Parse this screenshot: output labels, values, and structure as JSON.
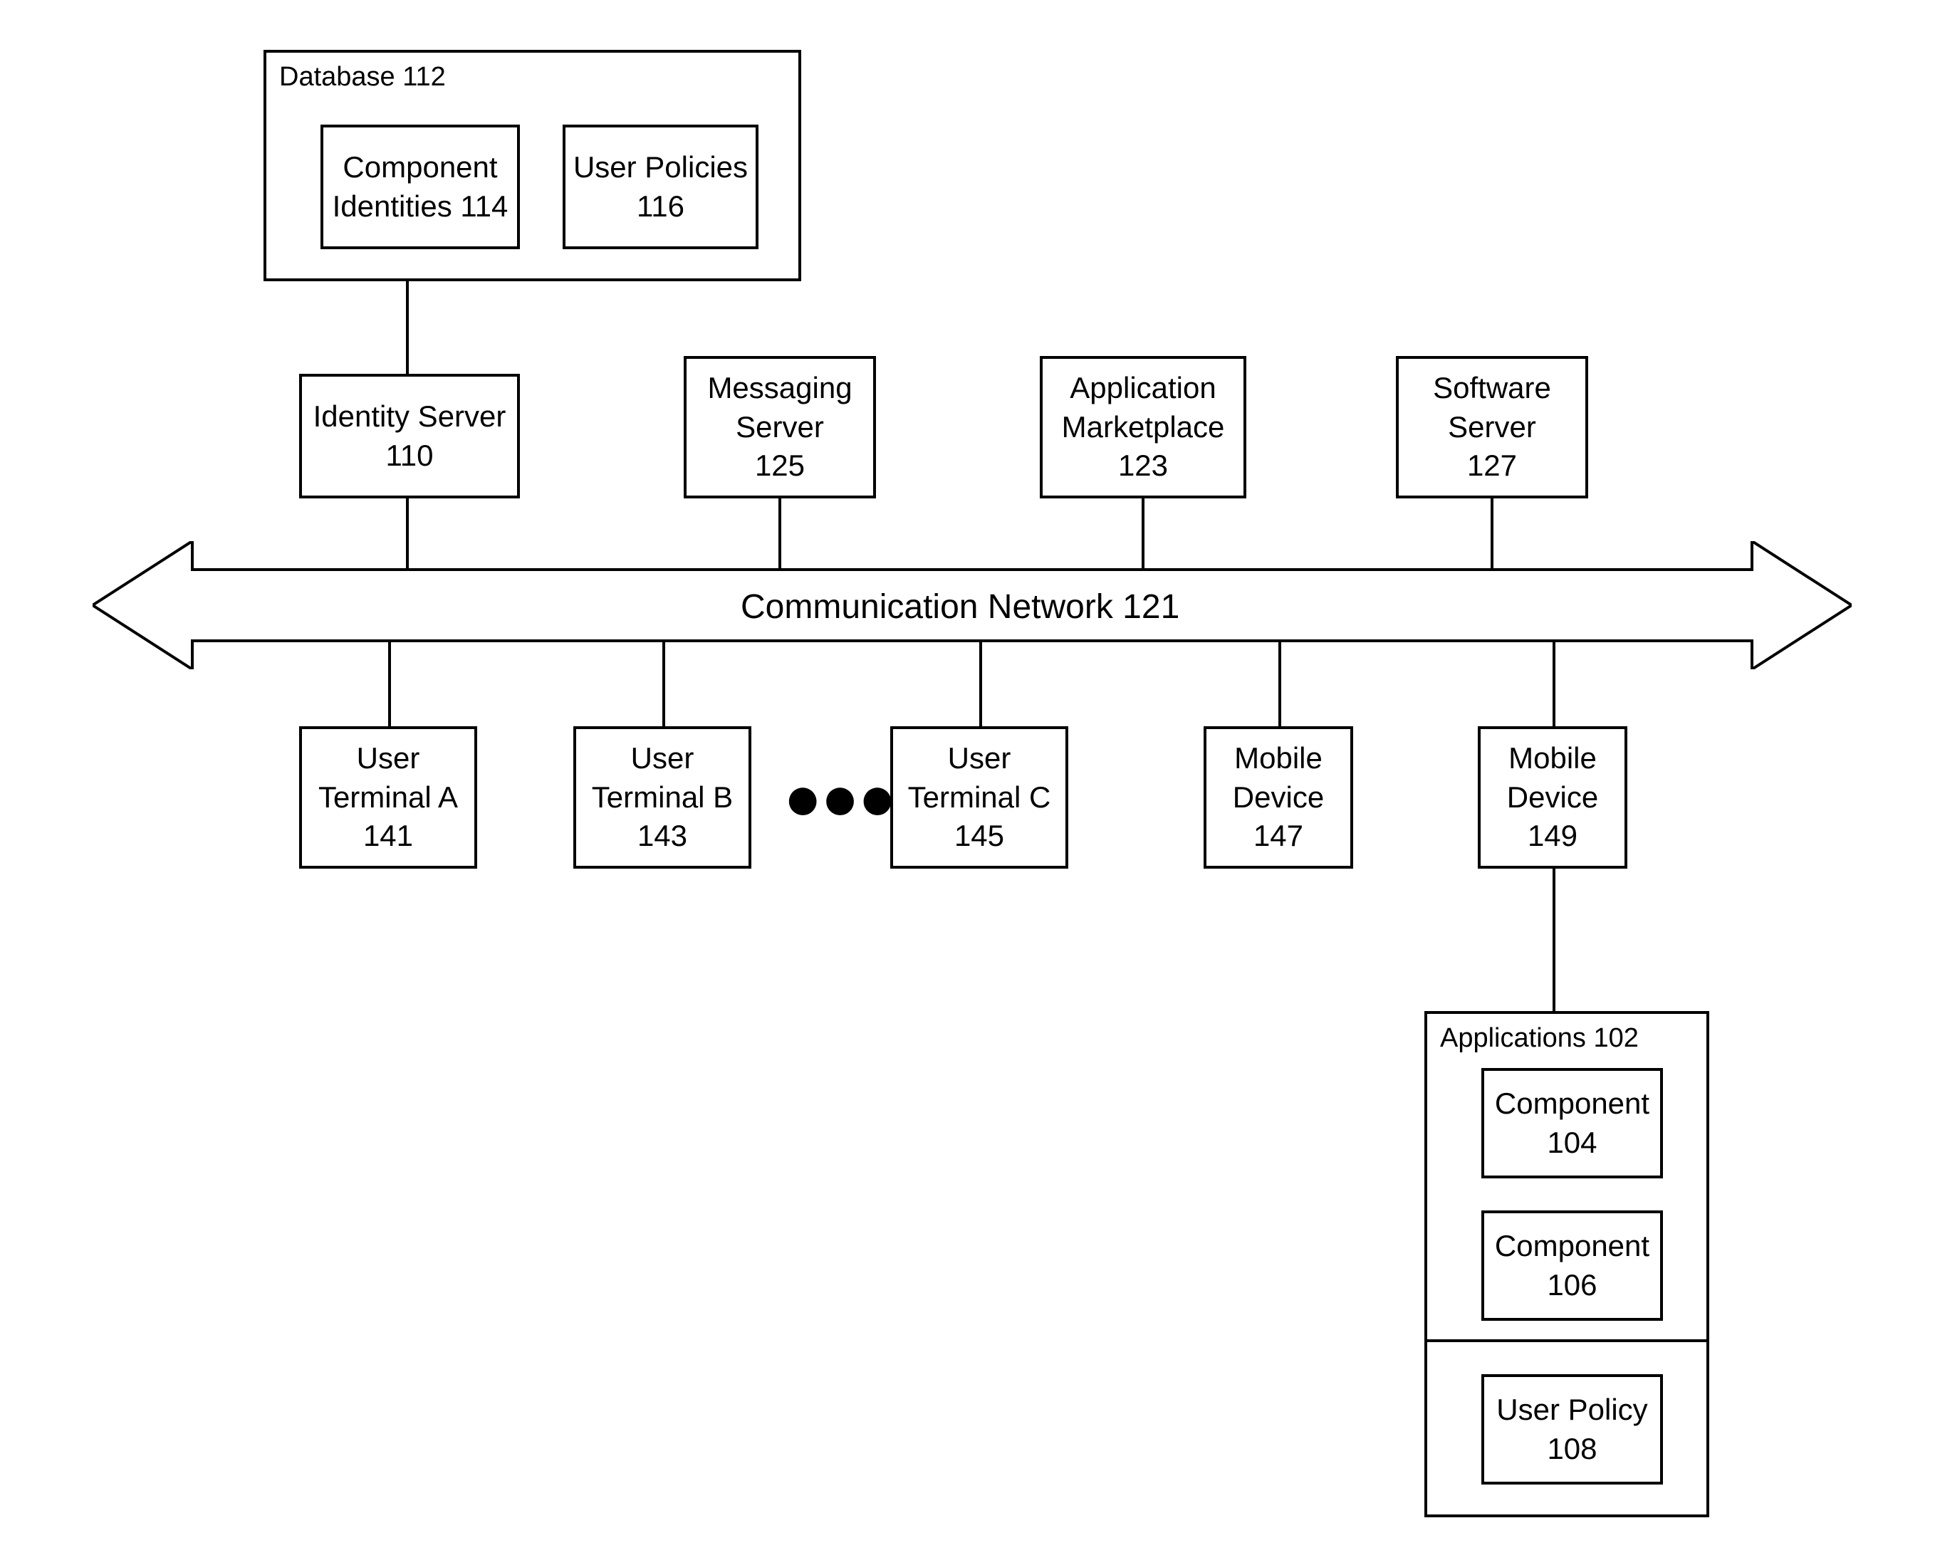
{
  "database": {
    "title": "Database 112",
    "component_identities": {
      "l1": "Component",
      "l2": "Identities 114"
    },
    "user_policies": {
      "l1": "User Policies",
      "l2": "116"
    }
  },
  "servers": {
    "identity": {
      "l1": "Identity Server",
      "l2": "110"
    },
    "messaging": {
      "l1": "Messaging",
      "l2": "Server",
      "l3": "125"
    },
    "marketplace": {
      "l1": "Application",
      "l2": "Marketplace",
      "l3": "123"
    },
    "software": {
      "l1": "Software",
      "l2": "Server",
      "l3": "127"
    }
  },
  "network": {
    "label": "Communication Network  121"
  },
  "terminals": {
    "a": {
      "l1": "User",
      "l2": "Terminal A",
      "l3": "141"
    },
    "b": {
      "l1": "User",
      "l2": "Terminal B",
      "l3": "143"
    },
    "c": {
      "l1": "User",
      "l2": "Terminal C",
      "l3": "145"
    },
    "mobile1": {
      "l1": "Mobile",
      "l2": "Device",
      "l3": "147"
    },
    "mobile2": {
      "l1": "Mobile",
      "l2": "Device",
      "l3": "149"
    }
  },
  "ellipsis": "●●●",
  "applications": {
    "title": "Applications 102",
    "comp1": {
      "l1": "Component",
      "l2": "104"
    },
    "comp2": {
      "l1": "Component",
      "l2": "106"
    },
    "policy": {
      "l1": "User Policy",
      "l2": "108"
    }
  }
}
